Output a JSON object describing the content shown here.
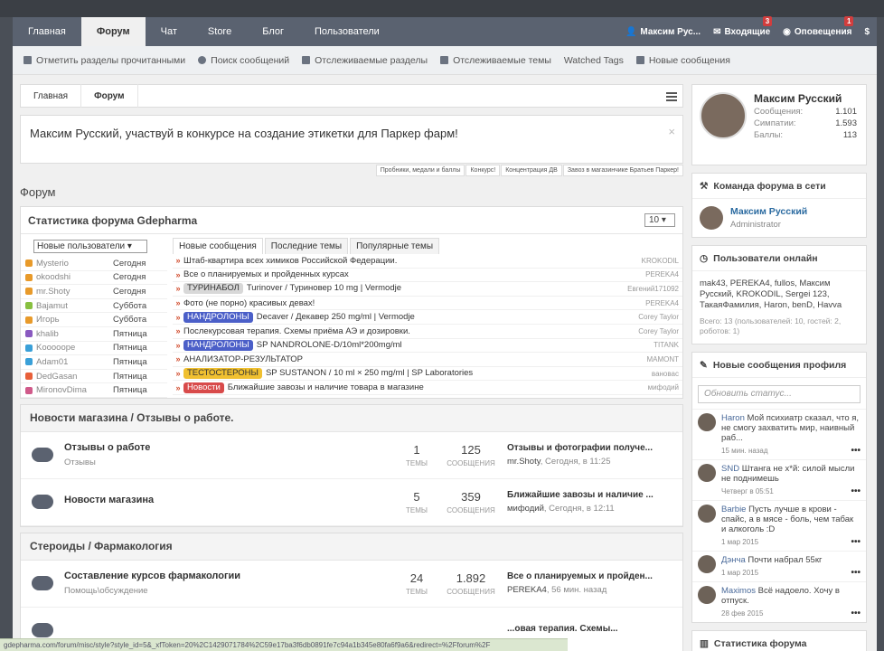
{
  "nav": {
    "tabs": [
      "Главная",
      "Форум",
      "Чат",
      "Store",
      "Блог",
      "Пользователи"
    ],
    "active": 1,
    "user": "Максим Рус...",
    "inbox": "Входящие",
    "inbox_badge": "3",
    "alerts": "Оповещения",
    "alerts_badge": "1",
    "dollar": "$"
  },
  "subnav": [
    "Отметить разделы прочитанными",
    "Поиск сообщений",
    "Отслеживаемые разделы",
    "Отслеживаемые темы",
    "Watched Tags",
    "Новые сообщения"
  ],
  "breadcrumb": [
    "Главная",
    "Форум"
  ],
  "notice": "Максим Русский, участвуй в конкурсе на создание этикетки для Паркер фарм!",
  "notice_close": "×",
  "ads": [
    "Пробники, медали и баллы",
    "Конкурс!",
    "Концентрация ДВ",
    "Завоз в магазинчике Братьев Паркер!"
  ],
  "forum_heading": "Форум",
  "stats": {
    "title": "Статистика форума Gdepharma",
    "count_select": "10 ▾",
    "users_select": "Новые пользователи ▾",
    "users": [
      {
        "name": "Mysterio",
        "date": "Сегодня",
        "color": "#e89a2a"
      },
      {
        "name": "okoodshi",
        "date": "Сегодня",
        "color": "#e89a2a"
      },
      {
        "name": "mr.Shoty",
        "date": "Сегодня",
        "color": "#e89a2a"
      },
      {
        "name": "Bajamut",
        "date": "Суббота",
        "color": "#88c040"
      },
      {
        "name": "Игорь",
        "date": "Суббота",
        "color": "#e89a2a"
      },
      {
        "name": "khalib",
        "date": "Пятница",
        "color": "#8a5ac0"
      },
      {
        "name": "Kooooope",
        "date": "Пятница",
        "color": "#3aa0d8"
      },
      {
        "name": "Adam01",
        "date": "Пятница",
        "color": "#3aa0d8"
      },
      {
        "name": "DedGasan",
        "date": "Пятница",
        "color": "#e8603a"
      },
      {
        "name": "MironovDima",
        "date": "Пятница",
        "color": "#d05a8a"
      }
    ],
    "tabs": [
      "Новые сообщения",
      "Последние темы",
      "Популярные темы"
    ],
    "posts": [
      {
        "prefix": "",
        "title": "Штаб-квартира всех химиков Российской Федерации.",
        "author": "KROKODIL"
      },
      {
        "prefix": "",
        "title": "Все о планируемых и пройденных курсах",
        "author": "PEREKA4"
      },
      {
        "prefix": "ТУРИНАБОЛ",
        "pc": "#d8d8d8",
        "pt": "#333",
        "title": "Turinover / Туриновер 10 mg | Vermodje",
        "author": "Евгений171092"
      },
      {
        "prefix": "",
        "title": "Фото (не порно) красивых девах!",
        "author": "PEREKA4"
      },
      {
        "prefix": "НАНДРОЛОНЫ",
        "pc": "#4b5fc8",
        "pt": "#fff",
        "title": "Decaver / Декавер 250 mg/ml | Vermodje",
        "author": "Corey Taylor"
      },
      {
        "prefix": "",
        "title": "Послекурсовая терапия. Схемы приёма АЭ и дозировки.",
        "author": "Corey Taylor"
      },
      {
        "prefix": "НАНДРОЛОНЫ",
        "pc": "#4b5fc8",
        "pt": "#fff",
        "title": "SP NANDROLONE-D/10ml*200mg/ml",
        "author": "TITANK"
      },
      {
        "prefix": "",
        "title": "АНАЛИЗАТОР-РЕЗУЛЬТАТОР",
        "author": "MAMONT"
      },
      {
        "prefix": "ТЕСТОСТЕРОНЫ",
        "pc": "#f0c030",
        "pt": "#333",
        "title": "SP SUSTANON / 10 ml × 250 mg/ml | SP Laboratories",
        "author": "вановас"
      },
      {
        "prefix": "Новости",
        "pc": "#d84a4a",
        "pt": "#fff",
        "title": "Ближайшие завозы и наличие товара в магазине",
        "author": "мифодий"
      }
    ]
  },
  "categories": [
    {
      "title": "Новости магазина / Отзывы о работе.",
      "nodes": [
        {
          "name": "Отзывы о работе",
          "sub": "Отзывы",
          "threads": "1",
          "posts": "125",
          "lt": "Отзывы и фотографии получе...",
          "lu": "mr.Shoty",
          "ld": ", Сегодня, в 11:25"
        },
        {
          "name": "Новости магазина",
          "sub": "",
          "threads": "5",
          "posts": "359",
          "lt": "Ближайшие завозы и наличие ...",
          "lu": "мифодий",
          "ld": ", Сегодня, в 12:11"
        }
      ]
    },
    {
      "title": "Стероиды / Фармакология",
      "nodes": [
        {
          "name": "Составление курсов фармакологии",
          "sub": "Помощь\\обсуждение",
          "threads": "24",
          "posts": "1.892",
          "lt": "Все о планируемых и пройден...",
          "lu": "PEREKA4",
          "ld": ", 56 мин. назад"
        },
        {
          "name": "",
          "sub": "",
          "threads": "",
          "posts": "",
          "lt": "...овая терапия. Схемы...",
          "lu": "",
          "ld": ""
        }
      ]
    }
  ],
  "labels": {
    "threads": "ТЕМЫ",
    "posts": "СООБЩЕНИЯ"
  },
  "profile": {
    "name": "Максим Русский",
    "rows": [
      [
        "Сообщения:",
        "1.101"
      ],
      [
        "Симпатии:",
        "1.593"
      ],
      [
        "Баллы:",
        "113"
      ]
    ]
  },
  "staff": {
    "title": "Команда форума в сети",
    "name": "Максим Русский",
    "role": "Administrator"
  },
  "online": {
    "title": "Пользователи онлайн",
    "list": "mak43, PEREKA4, fullos, Максим Русский, KROKODIL, Sergei 123, ТакаяФамилия, Haron, benD, Havva",
    "count": "Всего: 13 (пользователей: 10, гостей: 2, роботов: 1)"
  },
  "profile_posts": {
    "title": "Новые сообщения профиля",
    "placeholder": "Обновить статус...",
    "items": [
      {
        "user": "Haron",
        "text": "Мой психиатр сказал, что я, не смогу захватить мир, наивный раб...",
        "time": "15 мин. назад"
      },
      {
        "user": "SND",
        "text": "Штанга не х*й: силой мысли не поднимешь",
        "time": "Четверг в 05:51"
      },
      {
        "user": "Barbie",
        "text": "Пусть лучше в крови - спайс, а в мясе - боль, чем табак и алкоголь :D",
        "time": "1 мар 2015"
      },
      {
        "user": "Дэнча",
        "text": "Почти набрал 55кг",
        "time": "1 мар 2015"
      },
      {
        "user": "Maximos",
        "text": "Всё надоело. Хочу в отпуск.",
        "time": "28 фев 2015"
      }
    ]
  },
  "side_bottom": "Статистика форума",
  "statusbar": "gdepharma.com/forum/misc/style?style_id=5&_xfToken=20%2C1429071784%2C59e17ba3f6db0891fe7c94a1b345e80fa6f9a6&redirect=%2Fforum%2F"
}
